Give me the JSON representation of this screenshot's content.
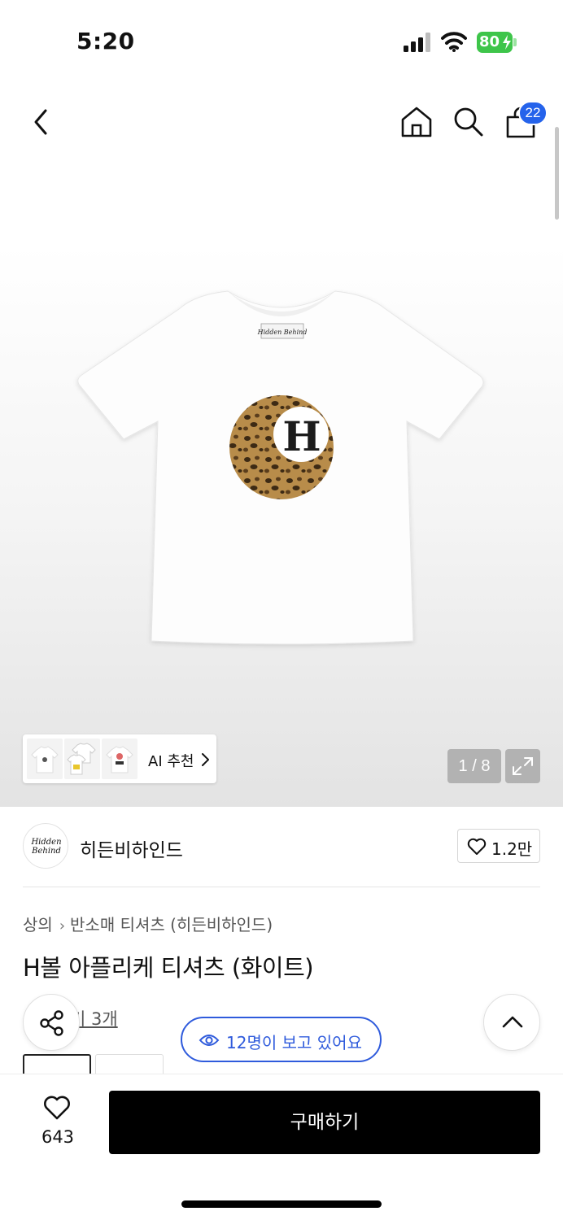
{
  "status_bar": {
    "time": "5:20",
    "battery_level": "80",
    "icons": [
      "signal-icon",
      "wifi-icon",
      "battery-charging-icon"
    ]
  },
  "nav": {
    "icons": [
      "back-icon",
      "home-icon",
      "search-icon",
      "shopping-bag-icon"
    ],
    "cart_badge": "22"
  },
  "gallery": {
    "ai_recommend_label": "AI 추천",
    "image_counter": "1 / 8",
    "expand_icon": "expand-icon"
  },
  "brand": {
    "logo_text_line1": "Hidden",
    "logo_text_line2": "Behind",
    "name": "히든비하인드",
    "like_count": "1.2만"
  },
  "product": {
    "breadcrumb": [
      "상의",
      "반소매 티셔츠 (히든비하인드)"
    ],
    "title": "H볼 아플리케 티셔츠 (화이트)",
    "review_link": "기 3개",
    "image_print_letter": "H"
  },
  "floating": {
    "viewers_text": "12명이 보고 있어요",
    "share_icon": "share-icon",
    "scroll_top_icon": "chevron-up-icon"
  },
  "bottom_bar": {
    "wish_count": "643",
    "buy_label": "구매하기"
  },
  "colors": {
    "accent_blue": "#2f5bdc",
    "badge_blue": "#2563eb",
    "battery_green": "#3ec54a",
    "buy_button": "#000000"
  }
}
